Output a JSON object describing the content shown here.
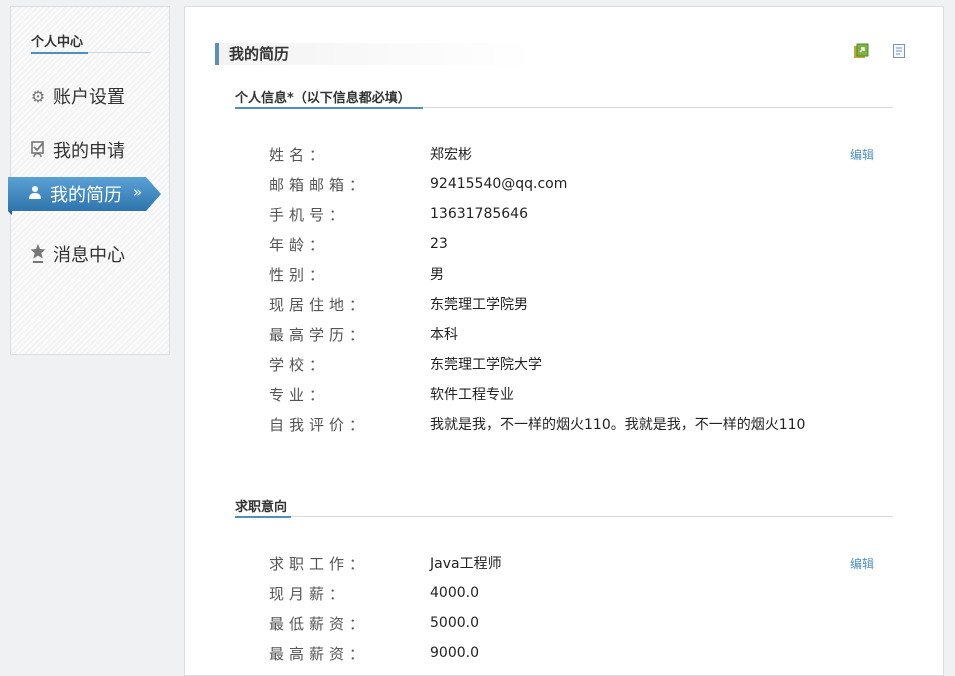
{
  "sidebar": {
    "title": "个人中心",
    "items": [
      {
        "label": "账户设置",
        "icon": "gear-icon"
      },
      {
        "label": "我的申请",
        "icon": "checkbox-icon"
      },
      {
        "label": "我的简历",
        "icon": "user-icon",
        "active": true
      },
      {
        "label": "消息中心",
        "icon": "star-icon"
      }
    ],
    "active_chevron": "»"
  },
  "main": {
    "title": "我的简历",
    "toolbar_icons": [
      "export-icon",
      "document-icon"
    ],
    "personal": {
      "heading": "个人信息*（以下信息都必填）",
      "edit_label": "编辑",
      "fields": [
        {
          "label": "姓名：",
          "value": "郑宏彬"
        },
        {
          "label": "邮箱邮箱：",
          "value": "92415540@qq.com"
        },
        {
          "label": "手机号：",
          "value": "13631785646"
        },
        {
          "label": "年龄：",
          "value": "23"
        },
        {
          "label": "性别：",
          "value": "男"
        },
        {
          "label": "现居住地：",
          "value": "东莞理工学院男"
        },
        {
          "label": "最高学历：",
          "value": "本科"
        },
        {
          "label": "学校：",
          "value": "东莞理工学院大学"
        },
        {
          "label": "专业：",
          "value": "软件工程专业"
        },
        {
          "label": "自我评价：",
          "value": "我就是我，不一样的烟火110。我就是我，不一样的烟火110"
        }
      ]
    },
    "intent": {
      "heading": "求职意向",
      "edit_label": "编辑",
      "fields": [
        {
          "label": "求职工作：",
          "value": "Java工程师"
        },
        {
          "label": "现月薪：",
          "value": "4000.0"
        },
        {
          "label": "最低薪资：",
          "value": "5000.0"
        },
        {
          "label": "最高薪资：",
          "value": "9000.0"
        }
      ]
    }
  },
  "colors": {
    "accent": "#4d8fbf",
    "active_tab": "#3f86be"
  }
}
